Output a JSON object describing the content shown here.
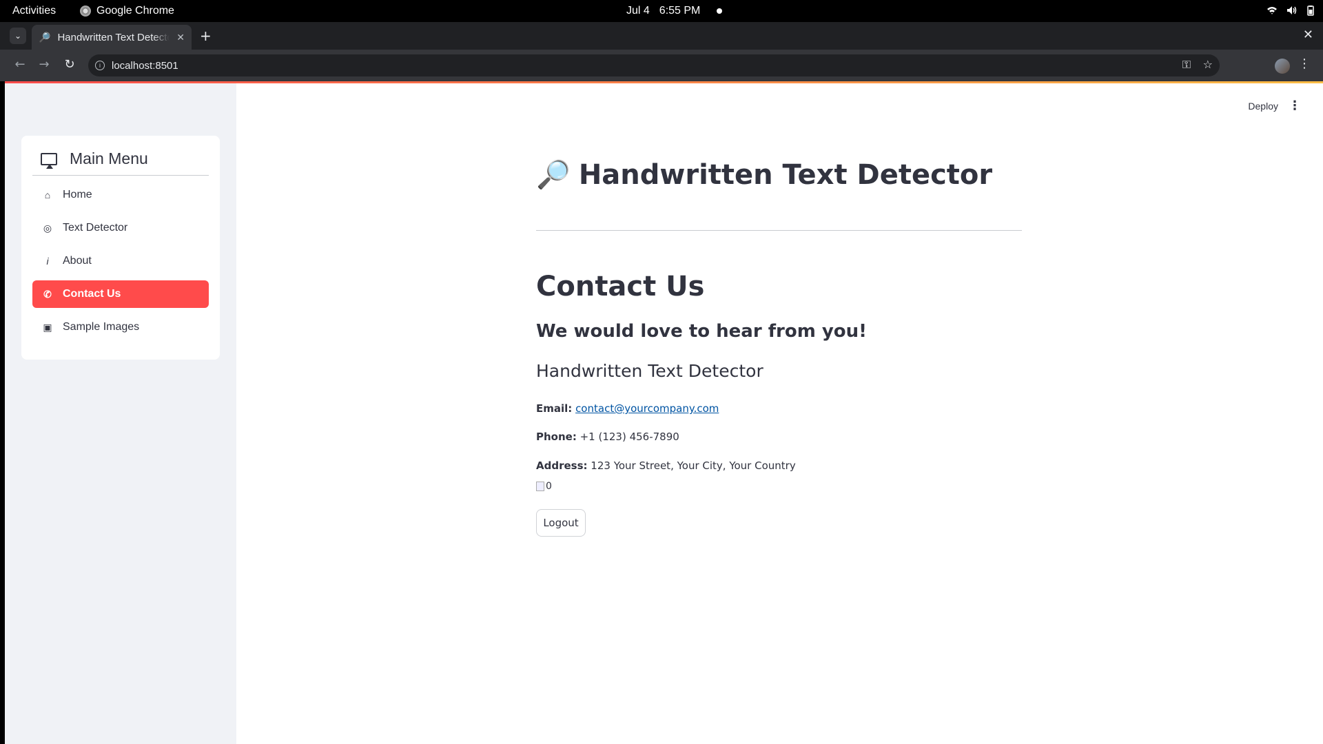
{
  "os": {
    "activities": "Activities",
    "app_name": "Google Chrome",
    "date": "Jul 4",
    "time": "6:55 PM"
  },
  "browser": {
    "tab_title": "Handwritten Text Detector",
    "tab_favicon": "🔎",
    "url": "localhost:8501"
  },
  "app": {
    "deploy_label": "Deploy",
    "menu_title": "Main Menu",
    "menu_items": [
      {
        "label": "Home",
        "icon": "house-icon",
        "glyph": "⌂"
      },
      {
        "label": "Text Detector",
        "icon": "camera-icon",
        "glyph": "◎"
      },
      {
        "label": "About",
        "icon": "info-icon",
        "glyph": "i"
      },
      {
        "label": "Contact Us",
        "icon": "phone-icon",
        "glyph": "✆",
        "active": true
      },
      {
        "label": "Sample Images",
        "icon": "image-icon",
        "glyph": "▣"
      }
    ],
    "page_title": "Handwritten Text Detector",
    "page_title_emoji": "🔎",
    "section_title": "Contact Us",
    "tagline": "We would love to hear from you!",
    "company": "Handwritten Text Detector",
    "email_label": "Email:",
    "email_value": "contact@yourcompany.com",
    "phone_label": "Phone:",
    "phone_value": "+1 (123) 456-7890",
    "address_label": "Address:",
    "address_value": "123 Your Street, Your City, Your Country",
    "broken_image_alt": "0",
    "logout_label": "Logout",
    "accent_color": "#ff4b4b"
  }
}
